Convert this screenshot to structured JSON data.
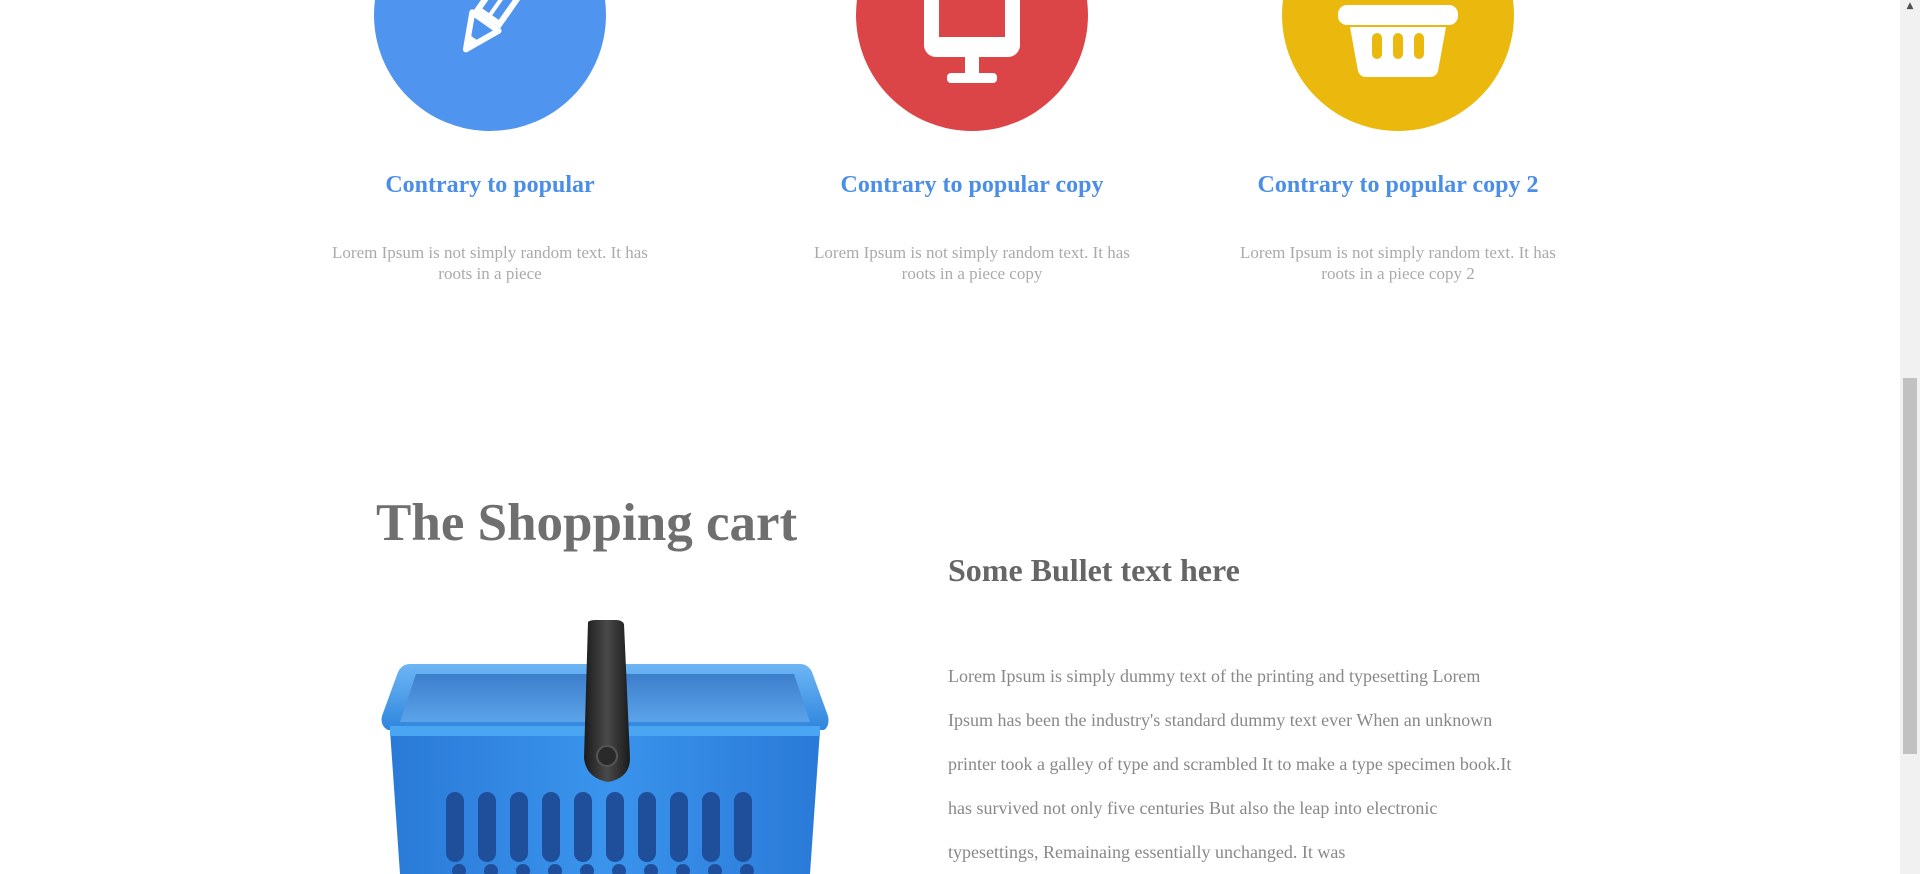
{
  "features": [
    {
      "icon": "pencil-icon",
      "color": "#4f94ef",
      "title": "Contrary to popular",
      "text": "Lorem Ipsum is not simply random text. It has roots in a piece"
    },
    {
      "icon": "monitor-icon",
      "color": "#dc4548",
      "title": "Contrary to popular copy",
      "text": "Lorem Ipsum is not simply random text. It has roots in a piece copy"
    },
    {
      "icon": "basket-icon",
      "color": "#ebb90e",
      "title": "Contrary to popular copy 2",
      "text": "Lorem Ipsum is not simply random text. It has roots in a piece copy 2"
    }
  ],
  "cart": {
    "heading": "The Shopping cart",
    "image": "shopping-basket-illustration"
  },
  "bullets": {
    "heading": "Some Bullet text here",
    "body": "Lorem Ipsum is simply dummy text of the printing and typesetting Lorem Ipsum has been the industry's standard dummy text ever When an unknown printer took a galley of type and scrambled It to make a type specimen book.It has survived not only five centuries But also the leap into electronic typesettings, Remainaing essentially unchanged. It was"
  },
  "scrollbar": {
    "up_arrow": "▲"
  }
}
